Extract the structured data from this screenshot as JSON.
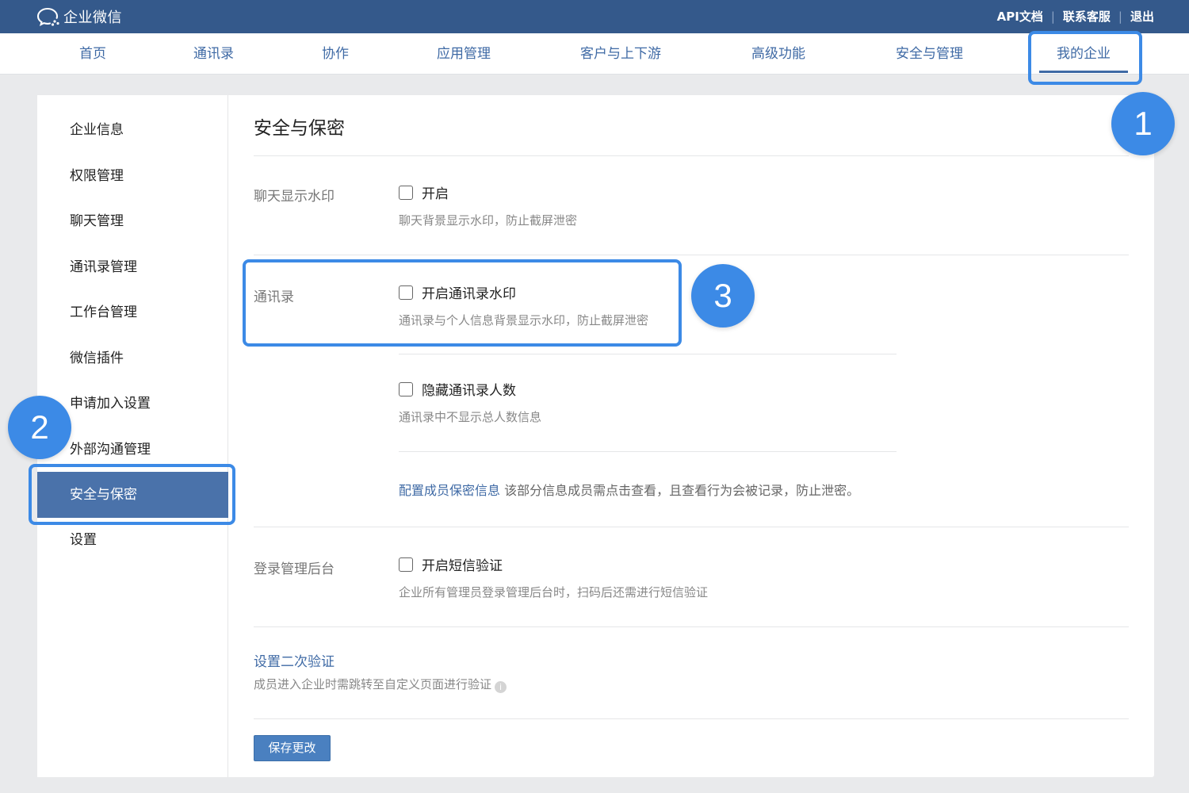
{
  "app": {
    "logo_text": "企业微信",
    "top_links": [
      "API文档",
      "联系客服",
      "退出"
    ]
  },
  "nav": [
    "首页",
    "通讯录",
    "协作",
    "应用管理",
    "客户与上下游",
    "高级功能",
    "安全与管理",
    "我的企业"
  ],
  "nav_active": "我的企业",
  "sidebar": [
    "企业信息",
    "权限管理",
    "聊天管理",
    "通讯录管理",
    "工作台管理",
    "微信插件",
    "申请加入设置",
    "外部沟通管理",
    "安全与保密",
    "设置"
  ],
  "sidebar_active": "安全与保密",
  "content": {
    "title": "安全与保密",
    "chat": {
      "label": "聊天显示水印",
      "option": "开启",
      "desc": "聊天背景显示水印，防止截屏泄密"
    },
    "contacts": {
      "label": "通讯录",
      "option1": "开启通讯录水印",
      "desc1": "通讯录与个人信息背景显示水印，防止截屏泄密",
      "option2": "隐藏通讯录人数",
      "desc2": "通讯录中不显示总人数信息",
      "config_link": "配置成员保密信息",
      "config_desc": "该部分信息成员需点击查看，且查看行为会被记录，防止泄密。"
    },
    "login": {
      "label": "登录管理后台",
      "option": "开启短信验证",
      "desc": "企业所有管理员登录管理后台时，扫码后还需进行短信验证"
    },
    "second_verify": {
      "link": "设置二次验证",
      "desc": "成员进入企业时需跳转至自定义页面进行验证"
    },
    "save_button": "保存更改"
  },
  "annotations": [
    "1",
    "2",
    "3"
  ],
  "colors": {
    "topbar": "#34598b",
    "accent": "#3f6aa5",
    "sidebar_active": "#4a72aa",
    "highlight": "#3c8ae6"
  }
}
